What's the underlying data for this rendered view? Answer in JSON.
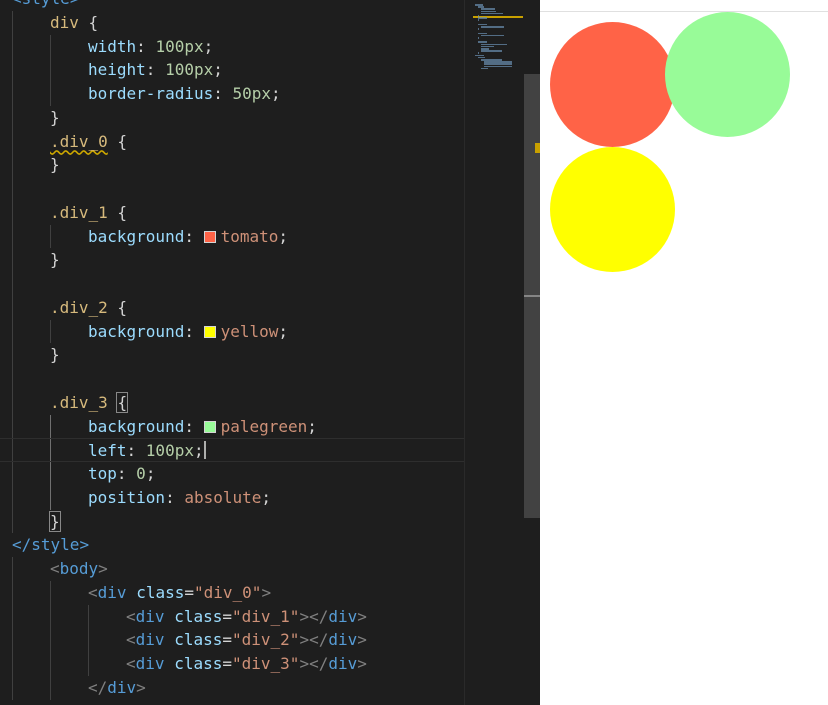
{
  "code_lines": [
    {
      "indent": 0,
      "tokens": [
        {
          "t": "<",
          "c": "tag"
        },
        {
          "t": "style",
          "c": "tag"
        },
        {
          "t": ">",
          "c": "tag"
        }
      ]
    },
    {
      "indent": 1,
      "tokens": [
        {
          "t": "div",
          "c": "sel"
        },
        {
          "t": " {",
          "c": "plain"
        }
      ]
    },
    {
      "indent": 2,
      "tokens": [
        {
          "t": "width",
          "c": "prop"
        },
        {
          "t": ": ",
          "c": "plain"
        },
        {
          "t": "100px",
          "c": "num"
        },
        {
          "t": ";",
          "c": "plain"
        }
      ]
    },
    {
      "indent": 2,
      "tokens": [
        {
          "t": "height",
          "c": "prop"
        },
        {
          "t": ": ",
          "c": "plain"
        },
        {
          "t": "100px",
          "c": "num"
        },
        {
          "t": ";",
          "c": "plain"
        }
      ]
    },
    {
      "indent": 2,
      "tokens": [
        {
          "t": "border-radius",
          "c": "prop"
        },
        {
          "t": ": ",
          "c": "plain"
        },
        {
          "t": "50px",
          "c": "num"
        },
        {
          "t": ";",
          "c": "plain"
        }
      ]
    },
    {
      "indent": 1,
      "tokens": [
        {
          "t": "}",
          "c": "plain"
        }
      ]
    },
    {
      "indent": 1,
      "tokens": [
        {
          "t": ".div_0",
          "c": "sel",
          "squiggle": true
        },
        {
          "t": " {",
          "c": "plain"
        }
      ]
    },
    {
      "indent": 1,
      "tokens": [
        {
          "t": "}",
          "c": "plain"
        }
      ]
    },
    {
      "indent": 1,
      "tokens": []
    },
    {
      "indent": 1,
      "tokens": [
        {
          "t": ".div_1",
          "c": "sel"
        },
        {
          "t": " {",
          "c": "plain"
        }
      ]
    },
    {
      "indent": 2,
      "tokens": [
        {
          "t": "background",
          "c": "prop"
        },
        {
          "t": ": ",
          "c": "plain"
        },
        {
          "swatch": "#ff6347"
        },
        {
          "t": "tomato",
          "c": "val"
        },
        {
          "t": ";",
          "c": "plain"
        }
      ]
    },
    {
      "indent": 1,
      "tokens": [
        {
          "t": "}",
          "c": "plain"
        }
      ]
    },
    {
      "indent": 1,
      "tokens": []
    },
    {
      "indent": 1,
      "tokens": [
        {
          "t": ".div_2",
          "c": "sel"
        },
        {
          "t": " {",
          "c": "plain"
        }
      ]
    },
    {
      "indent": 2,
      "tokens": [
        {
          "t": "background",
          "c": "prop"
        },
        {
          "t": ": ",
          "c": "plain"
        },
        {
          "swatch": "#ffff00"
        },
        {
          "t": "yellow",
          "c": "val"
        },
        {
          "t": ";",
          "c": "plain"
        }
      ]
    },
    {
      "indent": 1,
      "tokens": [
        {
          "t": "}",
          "c": "plain"
        }
      ]
    },
    {
      "indent": 1,
      "tokens": []
    },
    {
      "indent": 1,
      "tokens": [
        {
          "t": ".div_3",
          "c": "sel"
        },
        {
          "t": " ",
          "c": "plain"
        },
        {
          "t": "{",
          "c": "plain",
          "match": true
        }
      ]
    },
    {
      "indent": 2,
      "tokens": [
        {
          "t": "background",
          "c": "prop"
        },
        {
          "t": ": ",
          "c": "plain"
        },
        {
          "swatch": "#98fb98"
        },
        {
          "t": "palegreen",
          "c": "val"
        },
        {
          "t": ";",
          "c": "plain"
        }
      ]
    },
    {
      "indent": 2,
      "current": true,
      "tokens": [
        {
          "t": "left",
          "c": "prop"
        },
        {
          "t": ": ",
          "c": "plain"
        },
        {
          "t": "100px",
          "c": "num"
        },
        {
          "t": ";",
          "c": "plain"
        },
        {
          "cursor": true
        }
      ]
    },
    {
      "indent": 2,
      "tokens": [
        {
          "t": "top",
          "c": "prop"
        },
        {
          "t": ": ",
          "c": "plain"
        },
        {
          "t": "0",
          "c": "num"
        },
        {
          "t": ";",
          "c": "plain"
        }
      ]
    },
    {
      "indent": 2,
      "tokens": [
        {
          "t": "position",
          "c": "prop"
        },
        {
          "t": ": ",
          "c": "plain"
        },
        {
          "t": "absolute",
          "c": "val"
        },
        {
          "t": ";",
          "c": "plain"
        }
      ]
    },
    {
      "indent": 1,
      "tokens": [
        {
          "t": "}",
          "c": "plain",
          "match": true
        }
      ]
    },
    {
      "indent": 0,
      "tokens": [
        {
          "t": "</",
          "c": "tag"
        },
        {
          "t": "style",
          "c": "tag"
        },
        {
          "t": ">",
          "c": "tag"
        }
      ]
    },
    {
      "indent": 1,
      "tokens": [
        {
          "t": "<",
          "c": "punc"
        },
        {
          "t": "body",
          "c": "tag"
        },
        {
          "t": ">",
          "c": "punc"
        }
      ]
    },
    {
      "indent": 2,
      "tokens": [
        {
          "t": "<",
          "c": "punc"
        },
        {
          "t": "div",
          "c": "tag"
        },
        {
          "t": " ",
          "c": "plain"
        },
        {
          "t": "class",
          "c": "attr"
        },
        {
          "t": "=",
          "c": "plain"
        },
        {
          "t": "\"div_0\"",
          "c": "str"
        },
        {
          "t": ">",
          "c": "punc"
        }
      ]
    },
    {
      "indent": 3,
      "tokens": [
        {
          "t": "<",
          "c": "punc"
        },
        {
          "t": "div",
          "c": "tag"
        },
        {
          "t": " ",
          "c": "plain"
        },
        {
          "t": "class",
          "c": "attr"
        },
        {
          "t": "=",
          "c": "plain"
        },
        {
          "t": "\"div_1\"",
          "c": "str"
        },
        {
          "t": "></",
          "c": "punc"
        },
        {
          "t": "div",
          "c": "tag"
        },
        {
          "t": ">",
          "c": "punc"
        }
      ]
    },
    {
      "indent": 3,
      "tokens": [
        {
          "t": "<",
          "c": "punc"
        },
        {
          "t": "div",
          "c": "tag"
        },
        {
          "t": " ",
          "c": "plain"
        },
        {
          "t": "class",
          "c": "attr"
        },
        {
          "t": "=",
          "c": "plain"
        },
        {
          "t": "\"div_2\"",
          "c": "str"
        },
        {
          "t": "></",
          "c": "punc"
        },
        {
          "t": "div",
          "c": "tag"
        },
        {
          "t": ">",
          "c": "punc"
        }
      ]
    },
    {
      "indent": 3,
      "tokens": [
        {
          "t": "<",
          "c": "punc"
        },
        {
          "t": "div",
          "c": "tag"
        },
        {
          "t": " ",
          "c": "plain"
        },
        {
          "t": "class",
          "c": "attr"
        },
        {
          "t": "=",
          "c": "plain"
        },
        {
          "t": "\"div_3\"",
          "c": "str"
        },
        {
          "t": "></",
          "c": "punc"
        },
        {
          "t": "div",
          "c": "tag"
        },
        {
          "t": ">",
          "c": "punc"
        }
      ]
    },
    {
      "indent": 2,
      "tokens": [
        {
          "t": "</",
          "c": "punc"
        },
        {
          "t": "div",
          "c": "tag"
        },
        {
          "t": ">",
          "c": "punc"
        }
      ]
    }
  ],
  "preview": {
    "circles": [
      {
        "name": "div_1",
        "color": "#ff6347"
      },
      {
        "name": "div_2",
        "color": "#ffff00"
      },
      {
        "name": "div_3",
        "color": "#98fb98"
      }
    ]
  }
}
